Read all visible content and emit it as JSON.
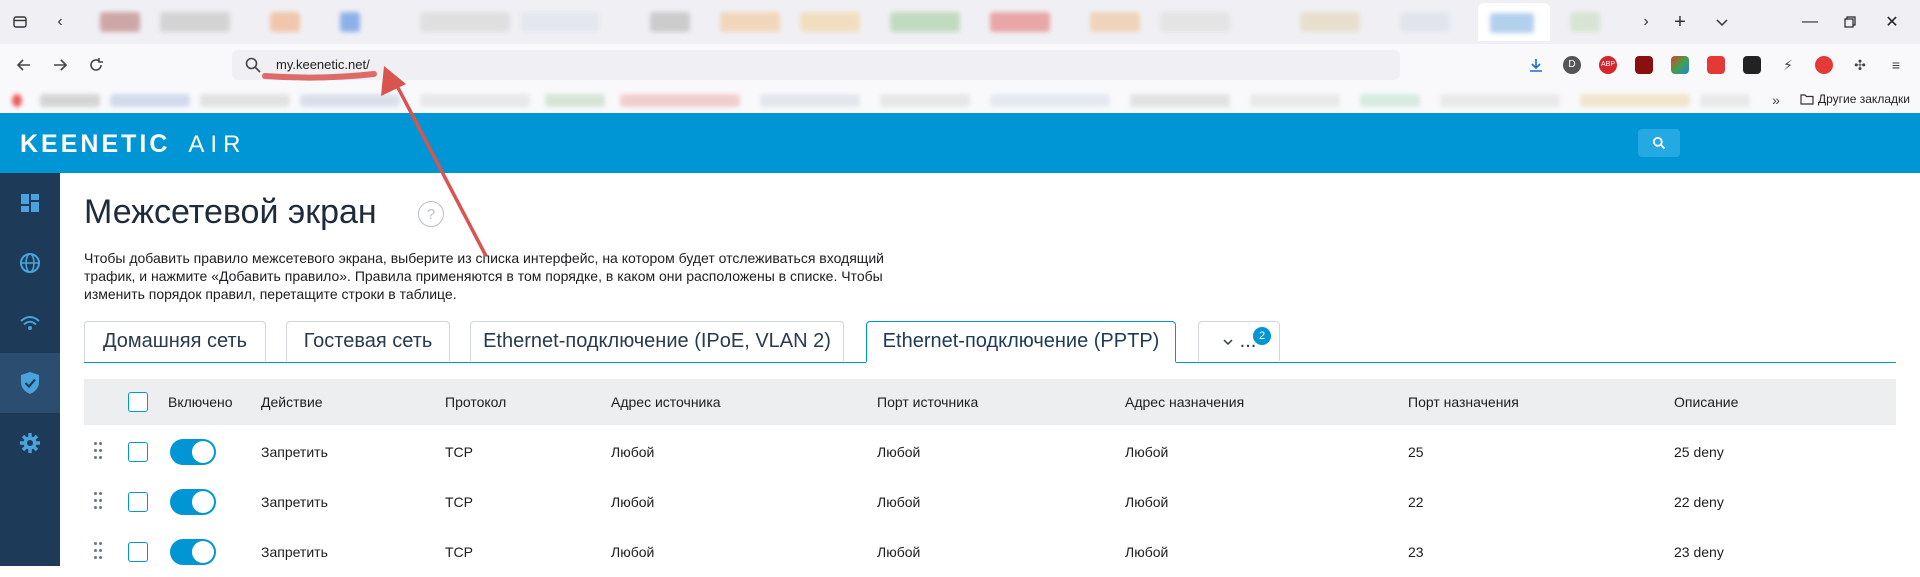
{
  "browser": {
    "url": "my.keenetic.net/",
    "other_bookmarks": "Другие закладки",
    "icons": [
      "list-all-tabs-icon",
      "back-icon",
      "forward-icon",
      "reload-icon",
      "search-icon",
      "download-icon",
      "new-tab-icon",
      "tab-menu-icon",
      "minimize-icon",
      "maximize-icon",
      "close-icon"
    ]
  },
  "header": {
    "brand": "KEENETIC",
    "model": "AIR"
  },
  "sidebar": {
    "items": [
      "dashboard-icon",
      "internet-globe-icon",
      "wifi-icon",
      "security-shield-icon",
      "settings-gear-icon"
    ],
    "active_index": 3
  },
  "page": {
    "title": "Межсетевой экран",
    "help": "?",
    "description": "Чтобы добавить правило межсетевого экрана, выберите из списка интерфейс, на котором будет отслеживаться входящий трафик, и нажмите «Добавить правило». Правила применяются в том порядке, в каком они расположены в списке. Чтобы изменить порядок правил, перетащите строки в таблице."
  },
  "tabs": [
    {
      "label": "Домашняя сеть"
    },
    {
      "label": "Гостевая сеть"
    },
    {
      "label": "Ethernet-подключение (IPoE, VLAN 2)"
    },
    {
      "label": "Ethernet-подключение (PPTP)",
      "active": true
    }
  ],
  "tab_more": {
    "label": "...",
    "badge": "2"
  },
  "table": {
    "columns": [
      "Включено",
      "Действие",
      "Протокол",
      "Адрес источника",
      "Порт источника",
      "Адрес назначения",
      "Порт назначения",
      "Описание"
    ],
    "rows": [
      {
        "enabled": true,
        "action": "Запретить",
        "protocol": "TCP",
        "src_addr": "Любой",
        "src_port": "Любой",
        "dst_addr": "Любой",
        "dst_port": "25",
        "description": "25 deny"
      },
      {
        "enabled": true,
        "action": "Запретить",
        "protocol": "TCP",
        "src_addr": "Любой",
        "src_port": "Любой",
        "dst_addr": "Любой",
        "dst_port": "22",
        "description": "22 deny"
      },
      {
        "enabled": true,
        "action": "Запретить",
        "protocol": "TCP",
        "src_addr": "Любой",
        "src_port": "Любой",
        "dst_addr": "Любой",
        "dst_port": "23",
        "description": "23 deny"
      }
    ]
  },
  "colors": {
    "brand_blue": "#0096d6",
    "sidebar_dark": "#1d3b59",
    "annotation_red": "#d9534f"
  }
}
